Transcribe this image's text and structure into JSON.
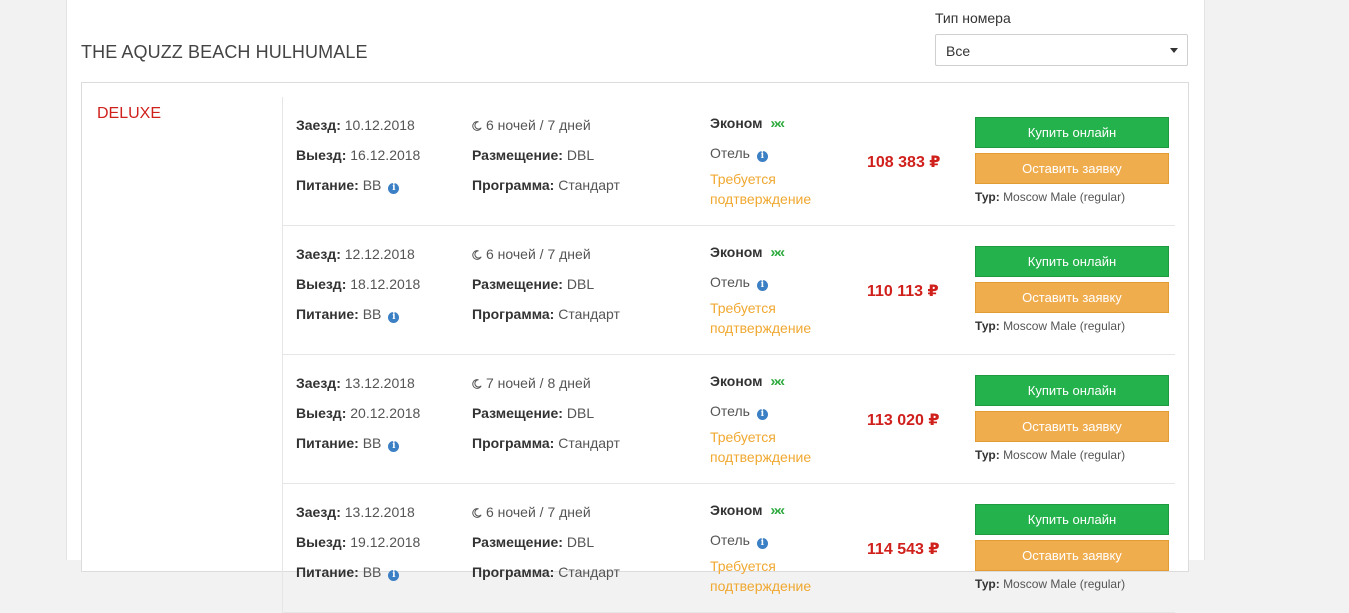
{
  "hotel": {
    "name": "THE AQUZZ BEACH HULHUMALE"
  },
  "filter": {
    "label": "Тип номера",
    "value": "Все"
  },
  "room": {
    "type": "DELUXE"
  },
  "labels": {
    "checkin": "Заезд:",
    "checkout": "Выезд:",
    "meal": "Питание:",
    "accommodation": "Размещение:",
    "program": "Программа:",
    "flight_class": "Эконом",
    "hotel": "Отель",
    "confirm": "Требуется подтверждение",
    "buy": "Купить онлайн",
    "request": "Оставить заявку",
    "tour": "Тур:"
  },
  "offers": [
    {
      "checkin": "10.12.2018",
      "checkout": "16.12.2018",
      "meal": "BB",
      "nights": "6 ночей / 7 дней",
      "accommodation": "DBL",
      "program": "Стандарт",
      "price": "108 383 ₽",
      "tour": "Moscow Male (regular)"
    },
    {
      "checkin": "12.12.2018",
      "checkout": "18.12.2018",
      "meal": "BB",
      "nights": "6 ночей / 7 дней",
      "accommodation": "DBL",
      "program": "Стандарт",
      "price": "110 113 ₽",
      "tour": "Moscow Male (regular)"
    },
    {
      "checkin": "13.12.2018",
      "checkout": "20.12.2018",
      "meal": "BB",
      "nights": "7 ночей / 8 дней",
      "accommodation": "DBL",
      "program": "Стандарт",
      "price": "113 020 ₽",
      "tour": "Moscow Male (regular)"
    },
    {
      "checkin": "13.12.2018",
      "checkout": "19.12.2018",
      "meal": "BB",
      "nights": "6 ночей / 7 дней",
      "accommodation": "DBL",
      "program": "Стандарт",
      "price": "114 543 ₽",
      "tour": "Moscow Male (regular)"
    }
  ],
  "colors": {
    "accent_red": "#d0201c",
    "buy_green": "#24b24c",
    "request_orange": "#f0ad4e",
    "confirm_orange": "#f0a830",
    "info_blue": "#3b7fc4"
  },
  "icons": {
    "nights": "moon-icon",
    "info": "info-icon",
    "flight": "chevrons-icon",
    "select": "caret-down-icon"
  }
}
